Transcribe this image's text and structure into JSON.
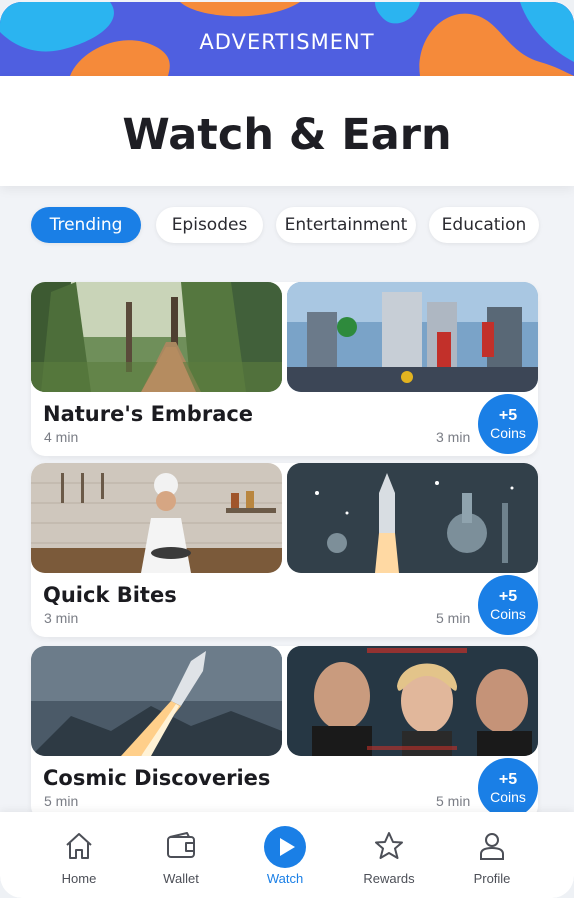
{
  "ad": {
    "label": "ADVERTISMENT"
  },
  "header": {
    "title": "Watch & Earn"
  },
  "categories": [
    {
      "label": "Trending",
      "active": true
    },
    {
      "label": "Episodes",
      "active": false
    },
    {
      "label": "Entertainment",
      "active": false
    },
    {
      "label": "Education",
      "active": false
    }
  ],
  "cards": [
    {
      "title": "Nature's Embrace",
      "duration_left": "4 min",
      "duration_right": "3 min",
      "coins_amount": "+5",
      "coins_label": "Coins",
      "thumb_left": "forest-path-image",
      "thumb_right": "robot-city-image"
    },
    {
      "title": "Quick Bites",
      "duration_left": "3 min",
      "duration_right": "5 min",
      "coins_amount": "+5",
      "coins_label": "Coins",
      "thumb_left": "chef-kitchen-image",
      "thumb_right": "rocket-lab-image"
    },
    {
      "title": "Cosmic Discoveries",
      "duration_left": "5 min",
      "duration_right": "5 min",
      "coins_amount": "+5",
      "coins_label": "Coins",
      "thumb_left": "rocket-launch-image",
      "thumb_right": "movie-poster-image"
    }
  ],
  "nav": [
    {
      "label": "Home",
      "icon": "home-icon",
      "active": false
    },
    {
      "label": "Wallet",
      "icon": "wallet-icon",
      "active": false
    },
    {
      "label": "Watch",
      "icon": "play-icon",
      "active": true
    },
    {
      "label": "Rewards",
      "icon": "star-icon",
      "active": false
    },
    {
      "label": "Profile",
      "icon": "user-icon",
      "active": false
    }
  ],
  "colors": {
    "accent": "#1a7fe6",
    "ad_blue": "#4f5fe0",
    "ad_orange": "#f58a3a",
    "ad_cyan": "#2bb4f0"
  }
}
